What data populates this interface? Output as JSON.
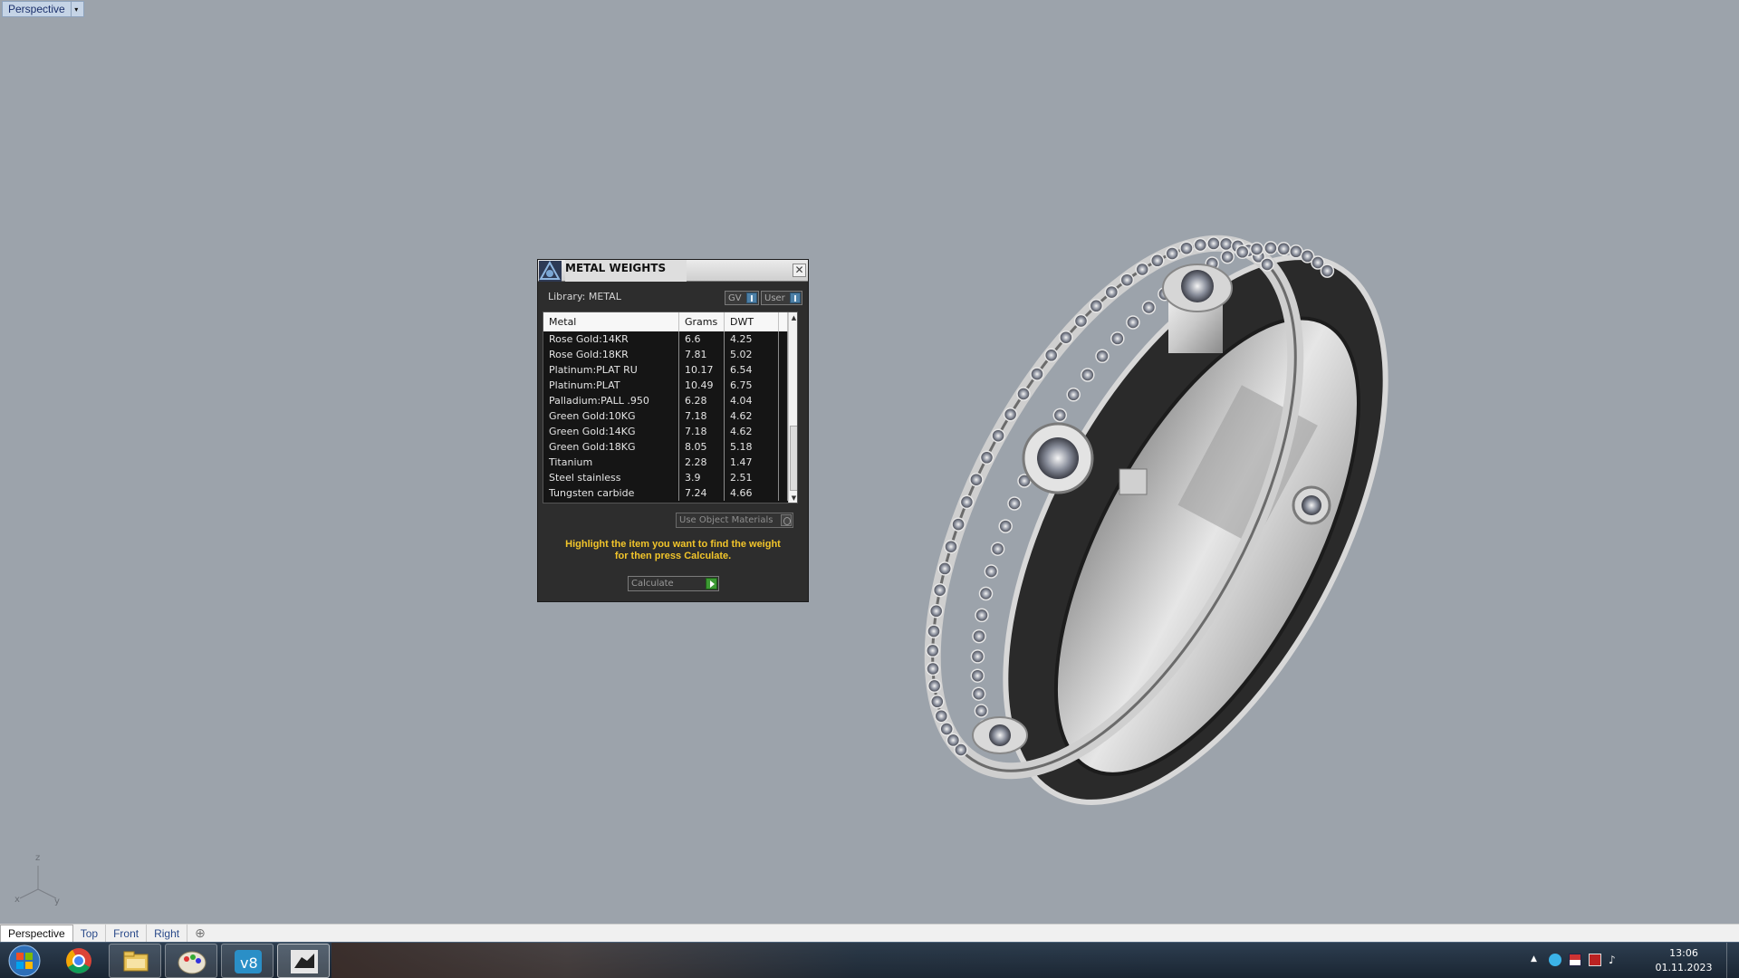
{
  "viewport": {
    "label": "Perspective",
    "dropdown_glyph": "▾",
    "axis": {
      "z": "z",
      "x": "x",
      "y": "y"
    }
  },
  "panel": {
    "title": "METAL WEIGHTS",
    "close_glyph": "✕",
    "library": "Library: METAL",
    "toggle_gv": "GV",
    "toggle_user": "User",
    "columns": [
      "Metal",
      "Grams",
      "DWT"
    ],
    "rows": [
      [
        "Rose Gold:14KR",
        "6.6",
        "4.25"
      ],
      [
        "Rose Gold:18KR",
        "7.81",
        "5.02"
      ],
      [
        "Platinum:PLAT RU",
        "10.17",
        "6.54"
      ],
      [
        "Platinum:PLAT",
        "10.49",
        "6.75"
      ],
      [
        "Palladium:PALL .950",
        "6.28",
        "4.04"
      ],
      [
        "Green Gold:10KG",
        "7.18",
        "4.62"
      ],
      [
        "Green Gold:14KG",
        "7.18",
        "4.62"
      ],
      [
        "Green Gold:18KG",
        "8.05",
        "5.18"
      ],
      [
        "Titanium",
        "2.28",
        "1.47"
      ],
      [
        "Steel stainless",
        "3.9",
        "2.51"
      ],
      [
        "Tungsten carbide",
        "7.24",
        "4.66"
      ]
    ],
    "scroll_up": "▲",
    "scroll_down": "▼",
    "use_object_materials": "Use Object Materials",
    "hint_line1": "Highlight the item you want to find the weight",
    "hint_line2": "for then press Calculate.",
    "calculate": "Calculate"
  },
  "tabs": {
    "items": [
      "Perspective",
      "Top",
      "Front",
      "Right"
    ],
    "active": "Perspective",
    "add_glyph": "⊕"
  },
  "taskbar": {
    "apps": [
      "chrome-icon",
      "file-explorer-icon",
      "paint-icon",
      "vray-icon",
      "rhino-icon"
    ],
    "time": "13:06",
    "date": "01.11.2023",
    "tray_arrow": "▲"
  },
  "colors": {
    "viewport_bg": "#9ca3ab",
    "panel_bg": "#2d2d2d",
    "hint_text": "#f2c52a",
    "taskbar_bg": "#1f2c3a"
  }
}
